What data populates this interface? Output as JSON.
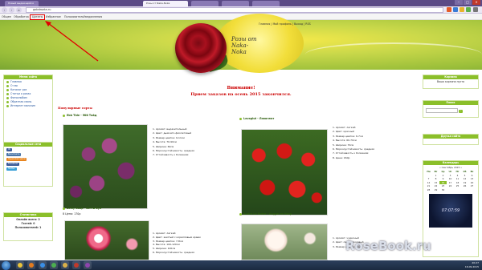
{
  "browser": {
    "tabs": [
      {
        "label": "Новый выдающийся",
        "active": false
      },
      {
        "label": "Розы от Naka-Noka",
        "active": true
      },
      {
        "label": "",
        "active": false
      },
      {
        "label": "",
        "active": false
      },
      {
        "label": "",
        "active": false
      }
    ],
    "url": "gobdrozta.ru",
    "bookmarks": [
      "Общее",
      "Обработка",
      "Цитаты",
      "Избранное",
      "Пользователь",
      "Уведомления"
    ]
  },
  "site": {
    "logo_text": "Розы от Naka-Noka",
    "top_links": "Главная | Мой профиль | Выход | RSS"
  },
  "left_sidebar": {
    "menu_title": "Меню сайта",
    "menu_items": [
      "Главная",
      "О нас",
      "Каталог роз",
      "Статьи о розах",
      "Фотоальбом",
      "Обратная связь",
      "Интернет магазин"
    ],
    "social_title": "Социальные сети",
    "social_buttons": [
      "Ж",
      "Вконтакте",
      "Одноклассники",
      "Facebook",
      "Twitter"
    ],
    "stats_title": "Статистика",
    "stats_lines": [
      "Онлайн всего: 2",
      "Гостей: 0",
      "Пользователей: 1"
    ]
  },
  "right_sidebar": {
    "cart_title": "Корзина",
    "cart_text": "Ваша корзина пуста",
    "search_title": "Поиск",
    "friends_title": "Друзья сайта",
    "calendar_title": "Календарь",
    "calendar_month": "« Сентябрь 2015 »",
    "calendar_headers": [
      "Пн",
      "Вт",
      "Ср",
      "Чт",
      "Пт",
      "Сб",
      "Вс"
    ],
    "calendar_days": [
      "",
      "1",
      "2",
      "3",
      "4",
      "5",
      "6",
      "7",
      "8",
      "9",
      "10",
      "11",
      "12",
      "13",
      "14",
      "15",
      "16",
      "17",
      "18",
      "19",
      "20",
      "21",
      "22",
      "23",
      "24",
      "25",
      "26",
      "27",
      "28",
      "29",
      "30",
      "",
      "",
      "",
      ""
    ],
    "clock_text": "07:07:59"
  },
  "main": {
    "alert_title": "Внимание!",
    "alert_text": "Прием заказов на осень 2015 закончился.",
    "popular_label": "Популярные сорта:",
    "products": [
      {
        "name": "Ebb Tide - Эбб Тайд",
        "specs": [
          "1. Аромат: выразительный",
          "2. Цвет: дымчато-фиолетовый",
          "3. Размер цветка: 9-11см",
          "4. Высота: 70-90см",
          "5. Ширина: 60см",
          "6. Морозоустойчивость: средняя",
          "7. Устойчивость к болезням:"
        ],
        "price": "8 Цена: 170р"
      },
      {
        "name": "Lavaglut - Лавоглют",
        "specs": [
          "1. Аромат: легкий",
          "2. Цвет: красный",
          "3. Размер цветка: 6-7см",
          "4. Высота: 60-70см",
          "5. Ширина: 70см",
          "6. Морозоустойчивость: средняя",
          "7. Устойчивость к болезням:",
          "8. Цена: 160р"
        ],
        "price": ""
      },
      {
        "name": "Betty Boop - Бетти Буп",
        "specs": [
          "1. Аромат: легкий",
          "2. Цвет: желтый с коралловым краем",
          "3. Размер цветка: 7-8см",
          "4. Высота: 100-120см",
          "5. Ширина: 100см",
          "6. Морозоустойчивость: средняя"
        ],
        "price": ""
      },
      {
        "name": "Andre Le Notre - Андре ле Нотр",
        "specs": [
          "1. Аромат: чудесный",
          "2. Цвет: светло-розовый",
          "3. Размер цветка: 10см"
        ],
        "price": ""
      }
    ]
  },
  "taskbar": {
    "time": "20:27",
    "date": "16.09.2015"
  },
  "watermark": "RoseBook.ru"
}
